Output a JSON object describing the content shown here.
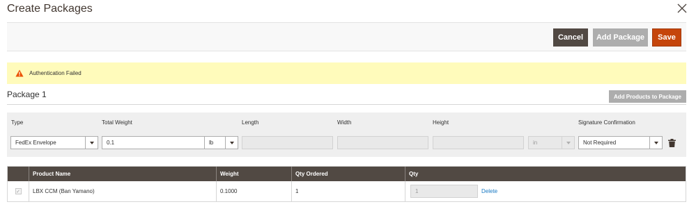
{
  "modal": {
    "title": "Create Packages"
  },
  "actions": {
    "cancel": "Cancel",
    "add_package": "Add Package",
    "save": "Save"
  },
  "message": {
    "text": "Authentication Failed"
  },
  "package": {
    "title": "Package 1",
    "add_products": "Add Products to Package",
    "labels": {
      "type": "Type",
      "total_weight": "Total Weight",
      "length": "Length",
      "width": "Width",
      "height": "Height",
      "signature": "Signature Confirmation"
    },
    "type_value": "FedEx Envelope",
    "weight_value": "0.1",
    "weight_unit": "lb",
    "length_value": "",
    "width_value": "",
    "height_value": "",
    "dimension_unit": "in",
    "signature_value": "Not Required"
  },
  "items_table": {
    "headers": [
      "",
      "Product Name",
      "Weight",
      "Qty Ordered",
      "Qty"
    ],
    "rows": [
      {
        "product_name": "LBX CCM (Ban Yamano)",
        "weight": "0.1000",
        "qty_ordered": "1",
        "qty": "1",
        "delete": "Delete"
      }
    ]
  },
  "colors": {
    "cancel": "#514943",
    "add_package": "#adadad",
    "save": "#c5450b",
    "message_bg": "#fffbbb",
    "header_bg": "#514943",
    "link": "#1979c3"
  }
}
